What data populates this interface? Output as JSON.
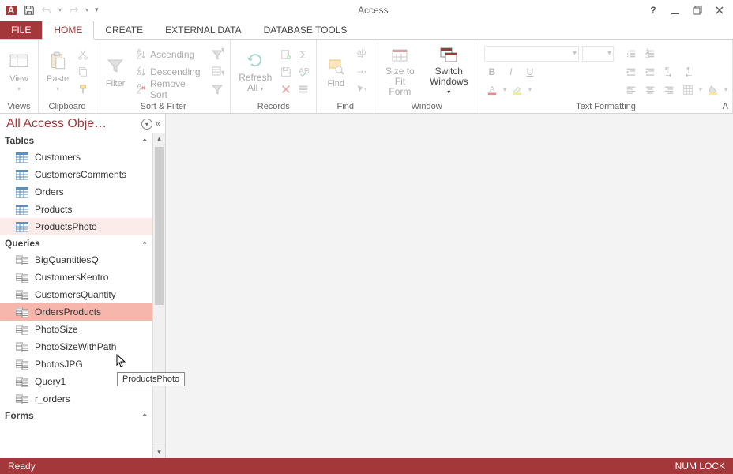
{
  "app_title": "Access",
  "tabs": {
    "file": "FILE",
    "home": "HOME",
    "create": "CREATE",
    "external": "EXTERNAL DATA",
    "dbtools": "DATABASE TOOLS"
  },
  "ribbon": {
    "views": {
      "view": "View",
      "group": "Views"
    },
    "clipboard": {
      "paste": "Paste",
      "group": "Clipboard"
    },
    "sortfilter": {
      "filter": "Filter",
      "asc": "Ascending",
      "desc": "Descending",
      "remove": "Remove Sort",
      "group": "Sort & Filter"
    },
    "records": {
      "refresh_l1": "Refresh",
      "refresh_l2": "All",
      "group": "Records"
    },
    "find": {
      "find": "Find",
      "group": "Find"
    },
    "window": {
      "size_l1": "Size to",
      "size_l2": "Fit Form",
      "switch_l1": "Switch",
      "switch_l2": "Windows",
      "group": "Window"
    },
    "text": {
      "group": "Text Formatting"
    }
  },
  "nav": {
    "header": "All Access Obje…",
    "sections": {
      "tables": "Tables",
      "queries": "Queries",
      "forms": "Forms"
    },
    "tables": [
      "Customers",
      "CustomersComments",
      "Orders",
      "Products",
      "ProductsPhoto"
    ],
    "queries": [
      "BigQuantitiesQ",
      "CustomersKentro",
      "CustomersQuantity",
      "OrdersProducts",
      "PhotoSize",
      "PhotoSizeWithPath",
      "PhotosJPG",
      "Query1",
      "r_orders"
    ],
    "selected_query": "OrdersProducts",
    "hovered_table": "ProductsPhoto",
    "tooltip": "ProductsPhoto"
  },
  "status": {
    "left": "Ready",
    "right": "NUM LOCK"
  }
}
